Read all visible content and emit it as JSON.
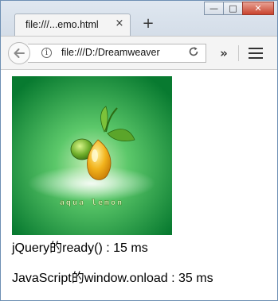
{
  "tab": {
    "title": "file:///...emo.html",
    "close_glyph": "×",
    "new_tab_glyph": "+"
  },
  "window_controls": {
    "minimize": "—",
    "maximize": "□",
    "close": "✕"
  },
  "navbar": {
    "back_icon": "arrow-left-icon",
    "url": "file:///D:/Dreamweaver",
    "info_icon": "info-icon",
    "reload_icon": "reload-icon",
    "overflow_icon": "double-chevron-right-icon",
    "menu_icon": "hamburger-menu-icon"
  },
  "page": {
    "logo_text": "aqua lemon",
    "jquery_line": "jQuery的ready() : 15 ms",
    "onload_line": "JavaScript的window.onload : 35 ms"
  },
  "colors": {
    "logo_green_dark": "#0a7a2e",
    "logo_green_light": "#7fd97a",
    "lemon_yellow": "#f2b31c"
  }
}
